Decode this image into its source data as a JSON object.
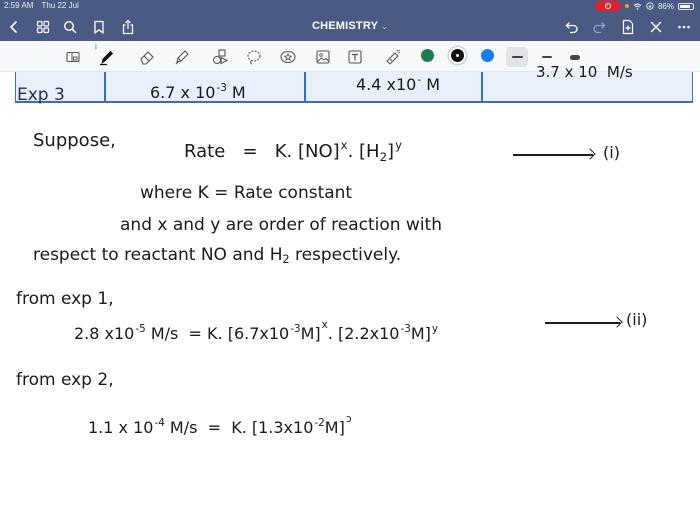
{
  "status_bar": {
    "time": "2:59 AM",
    "date": "Thu 22 Jul",
    "battery_percent": "86%",
    "battery_level": 0.86,
    "recording_icon": "screen-record-icon",
    "wifi_icon": "wifi-icon",
    "orientation_lock_icon": "orientation-lock-icon"
  },
  "nav": {
    "title": "CHEMISTRY",
    "title_caret": "⌄",
    "left_icons": [
      "back-icon",
      "grid-icon",
      "search-icon",
      "bookmark-icon",
      "share-icon"
    ],
    "right_icons": [
      "undo-icon",
      "redo-icon",
      "add-page-icon",
      "close-icon",
      "more-icon"
    ]
  },
  "toolbar": {
    "tools": [
      "read-mode-icon",
      "pen-icon",
      "eraser-icon",
      "highlighter-icon",
      "shapes-icon",
      "lasso-icon",
      "sticker-icon",
      "image-icon",
      "text-icon",
      "laser-pointer-icon"
    ],
    "bluetooth_badge": "ᛒ",
    "colors": [
      "#1e7a55",
      "#111111",
      "#1b7ee8"
    ],
    "selected_color": "#111111",
    "stroke_sizes": [
      "thin",
      "medium",
      "thick"
    ],
    "selected_stroke": "thin"
  },
  "notes": {
    "table_row": {
      "label": "Exp 3",
      "col2": "6.7 x 10",
      "col2_exp": "-3",
      "col2_unit": " M",
      "col3": "4.4 x10",
      "col3_exp": "-",
      "col3_unit": " M",
      "col4": "3.7 x 10",
      "col4_unit": "M/s"
    },
    "line1": {
      "lead": "Suppose,",
      "eq_lhs": "Rate",
      "eq_eq": "=",
      "eq_k": "K. [NO]",
      "eq_x": "x",
      "eq_dot": ". [H",
      "eq_h_sub": "2",
      "eq_close": "]",
      "eq_y": "y",
      "label": "(i)"
    },
    "line2": {
      "text": "where  K =  Rate constant"
    },
    "line3": {
      "text": "and  x  and  y   are  order  of  reaction  with"
    },
    "line4": {
      "text_a": "respect   to   reactant   NO   and  H",
      "sub": "2",
      "text_b": " respectively."
    },
    "line5": {
      "text": "from  exp 1,"
    },
    "line6": {
      "lhs": "2.8 x10",
      "lhs_exp": "-5",
      "lhs_unit": " M/s",
      "eq": "=",
      "rhs_a": "K. [6.7x10",
      "rhs_a_exp": "-3",
      "rhs_a_unit": "M]",
      "rhs_x": "x",
      "rhs_b": ". [2.2x10",
      "rhs_b_exp": "-3",
      "rhs_b_unit": "M]",
      "rhs_y": "y",
      "label": "(ii)"
    },
    "line7": {
      "text": "from  exp 2,"
    },
    "line8": {
      "lhs": "1.1 x 10",
      "lhs_exp": "-4",
      "lhs_unit": " M/s",
      "eq": "=",
      "rhs": "K. [1.3x10",
      "rhs_exp": "-2",
      "rhs_unit": "M]",
      "rhs_partial": "ɔ"
    }
  }
}
